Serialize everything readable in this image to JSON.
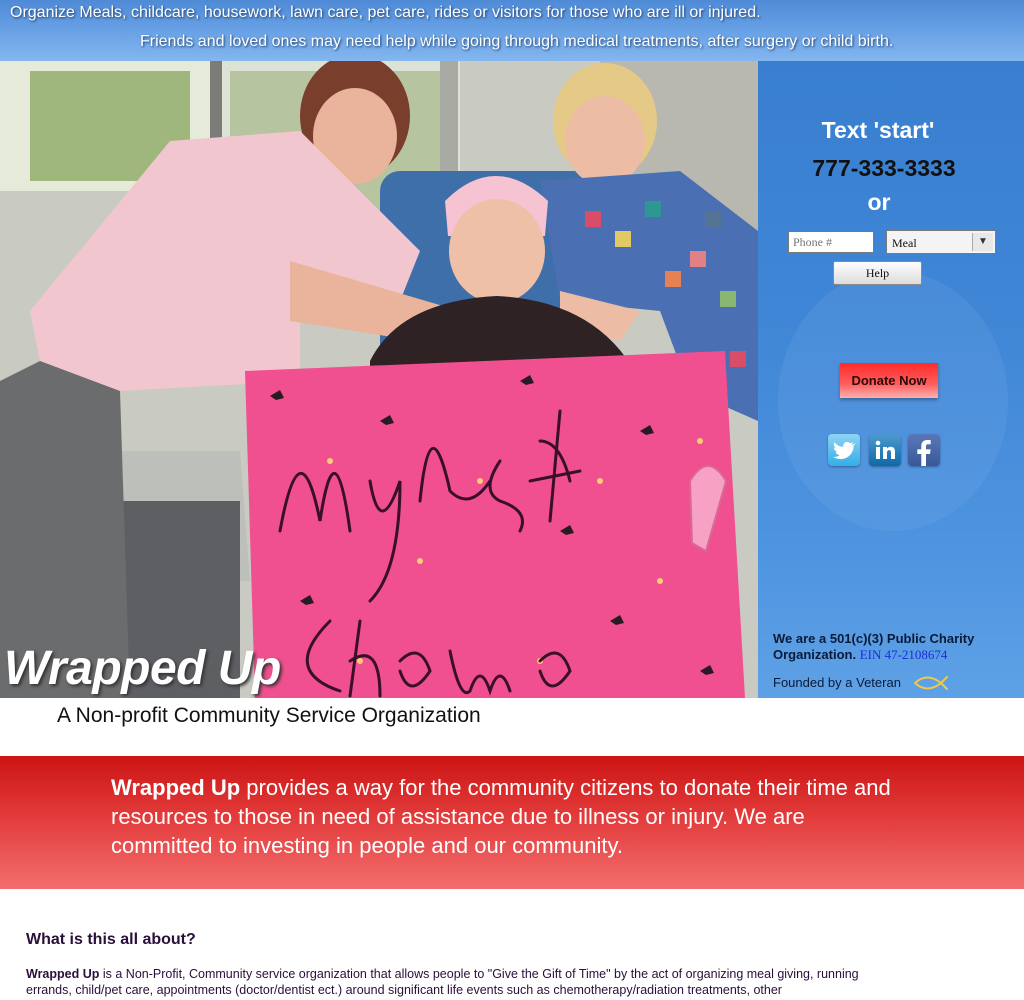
{
  "banner": {
    "line1": "Organize  Meals, childcare, housework, lawn care, pet care, rides or visitors for those who are ill or injured.",
    "line2": "Friends and loved ones may need help while going through medical treatments, after surgery or child birth."
  },
  "hero": {
    "brand": "Wrapped Up",
    "sign_text": "My Last Chemo"
  },
  "panel": {
    "text_start": "Text 'start'",
    "phone_number": "777-333-3333",
    "or_label": "or",
    "phone_placeholder": "Phone #",
    "meal_selected": "Meal",
    "help_label": "Help",
    "donate_label": "Donate Now",
    "social_icons": [
      "twitter-icon",
      "linkedin-icon",
      "facebook-icon"
    ],
    "charity_text": "We are  a 501(c)(3) Public Charity Organization.",
    "ein_text": "EIN 47-2108674",
    "veteran_text": "Founded by a Veteran"
  },
  "tagline": "A Non-profit Community Service Organization",
  "mission": {
    "brand": "Wrapped Up",
    "text": " provides a way for the community citizens to donate their time and resources to those in need of assistance due to illness or injury. We are committed to investing in people and our community."
  },
  "about": {
    "title": "What is this all about?",
    "brand": "Wrapped Up",
    "body": " is a Non-Profit, Community service organization that allows people to \"Give the Gift of Time\" by the act of organizing meal giving, running errands, child/pet care, appointments (doctor/dentist ect.) around significant life events such as chemotherapy/radiation treatments, other"
  },
  "colors": {
    "banner_blue": "#5f9ae0",
    "panel_blue": "#3f86d6",
    "mission_red": "#e23a3a",
    "sign_pink": "#f0508f"
  }
}
